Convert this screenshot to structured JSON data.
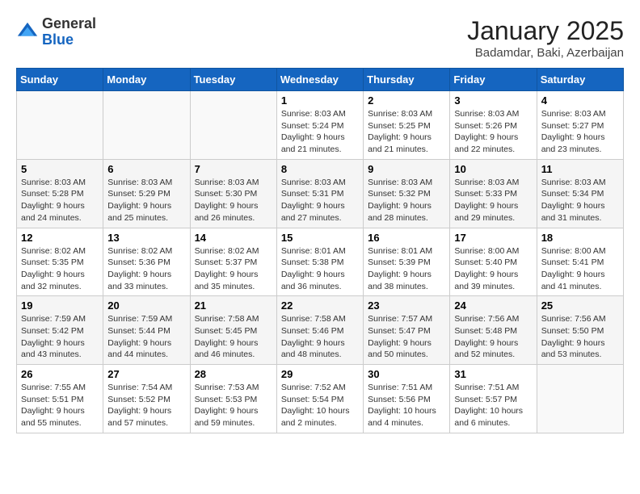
{
  "header": {
    "logo_general": "General",
    "logo_blue": "Blue",
    "month_title": "January 2025",
    "subtitle": "Badamdar, Baki, Azerbaijan"
  },
  "weekdays": [
    "Sunday",
    "Monday",
    "Tuesday",
    "Wednesday",
    "Thursday",
    "Friday",
    "Saturday"
  ],
  "weeks": [
    [
      {
        "day": "",
        "info": ""
      },
      {
        "day": "",
        "info": ""
      },
      {
        "day": "",
        "info": ""
      },
      {
        "day": "1",
        "info": "Sunrise: 8:03 AM\nSunset: 5:24 PM\nDaylight: 9 hours\nand 21 minutes."
      },
      {
        "day": "2",
        "info": "Sunrise: 8:03 AM\nSunset: 5:25 PM\nDaylight: 9 hours\nand 21 minutes."
      },
      {
        "day": "3",
        "info": "Sunrise: 8:03 AM\nSunset: 5:26 PM\nDaylight: 9 hours\nand 22 minutes."
      },
      {
        "day": "4",
        "info": "Sunrise: 8:03 AM\nSunset: 5:27 PM\nDaylight: 9 hours\nand 23 minutes."
      }
    ],
    [
      {
        "day": "5",
        "info": "Sunrise: 8:03 AM\nSunset: 5:28 PM\nDaylight: 9 hours\nand 24 minutes."
      },
      {
        "day": "6",
        "info": "Sunrise: 8:03 AM\nSunset: 5:29 PM\nDaylight: 9 hours\nand 25 minutes."
      },
      {
        "day": "7",
        "info": "Sunrise: 8:03 AM\nSunset: 5:30 PM\nDaylight: 9 hours\nand 26 minutes."
      },
      {
        "day": "8",
        "info": "Sunrise: 8:03 AM\nSunset: 5:31 PM\nDaylight: 9 hours\nand 27 minutes."
      },
      {
        "day": "9",
        "info": "Sunrise: 8:03 AM\nSunset: 5:32 PM\nDaylight: 9 hours\nand 28 minutes."
      },
      {
        "day": "10",
        "info": "Sunrise: 8:03 AM\nSunset: 5:33 PM\nDaylight: 9 hours\nand 29 minutes."
      },
      {
        "day": "11",
        "info": "Sunrise: 8:03 AM\nSunset: 5:34 PM\nDaylight: 9 hours\nand 31 minutes."
      }
    ],
    [
      {
        "day": "12",
        "info": "Sunrise: 8:02 AM\nSunset: 5:35 PM\nDaylight: 9 hours\nand 32 minutes."
      },
      {
        "day": "13",
        "info": "Sunrise: 8:02 AM\nSunset: 5:36 PM\nDaylight: 9 hours\nand 33 minutes."
      },
      {
        "day": "14",
        "info": "Sunrise: 8:02 AM\nSunset: 5:37 PM\nDaylight: 9 hours\nand 35 minutes."
      },
      {
        "day": "15",
        "info": "Sunrise: 8:01 AM\nSunset: 5:38 PM\nDaylight: 9 hours\nand 36 minutes."
      },
      {
        "day": "16",
        "info": "Sunrise: 8:01 AM\nSunset: 5:39 PM\nDaylight: 9 hours\nand 38 minutes."
      },
      {
        "day": "17",
        "info": "Sunrise: 8:00 AM\nSunset: 5:40 PM\nDaylight: 9 hours\nand 39 minutes."
      },
      {
        "day": "18",
        "info": "Sunrise: 8:00 AM\nSunset: 5:41 PM\nDaylight: 9 hours\nand 41 minutes."
      }
    ],
    [
      {
        "day": "19",
        "info": "Sunrise: 7:59 AM\nSunset: 5:42 PM\nDaylight: 9 hours\nand 43 minutes."
      },
      {
        "day": "20",
        "info": "Sunrise: 7:59 AM\nSunset: 5:44 PM\nDaylight: 9 hours\nand 44 minutes."
      },
      {
        "day": "21",
        "info": "Sunrise: 7:58 AM\nSunset: 5:45 PM\nDaylight: 9 hours\nand 46 minutes."
      },
      {
        "day": "22",
        "info": "Sunrise: 7:58 AM\nSunset: 5:46 PM\nDaylight: 9 hours\nand 48 minutes."
      },
      {
        "day": "23",
        "info": "Sunrise: 7:57 AM\nSunset: 5:47 PM\nDaylight: 9 hours\nand 50 minutes."
      },
      {
        "day": "24",
        "info": "Sunrise: 7:56 AM\nSunset: 5:48 PM\nDaylight: 9 hours\nand 52 minutes."
      },
      {
        "day": "25",
        "info": "Sunrise: 7:56 AM\nSunset: 5:50 PM\nDaylight: 9 hours\nand 53 minutes."
      }
    ],
    [
      {
        "day": "26",
        "info": "Sunrise: 7:55 AM\nSunset: 5:51 PM\nDaylight: 9 hours\nand 55 minutes."
      },
      {
        "day": "27",
        "info": "Sunrise: 7:54 AM\nSunset: 5:52 PM\nDaylight: 9 hours\nand 57 minutes."
      },
      {
        "day": "28",
        "info": "Sunrise: 7:53 AM\nSunset: 5:53 PM\nDaylight: 9 hours\nand 59 minutes."
      },
      {
        "day": "29",
        "info": "Sunrise: 7:52 AM\nSunset: 5:54 PM\nDaylight: 10 hours\nand 2 minutes."
      },
      {
        "day": "30",
        "info": "Sunrise: 7:51 AM\nSunset: 5:56 PM\nDaylight: 10 hours\nand 4 minutes."
      },
      {
        "day": "31",
        "info": "Sunrise: 7:51 AM\nSunset: 5:57 PM\nDaylight: 10 hours\nand 6 minutes."
      },
      {
        "day": "",
        "info": ""
      }
    ]
  ]
}
